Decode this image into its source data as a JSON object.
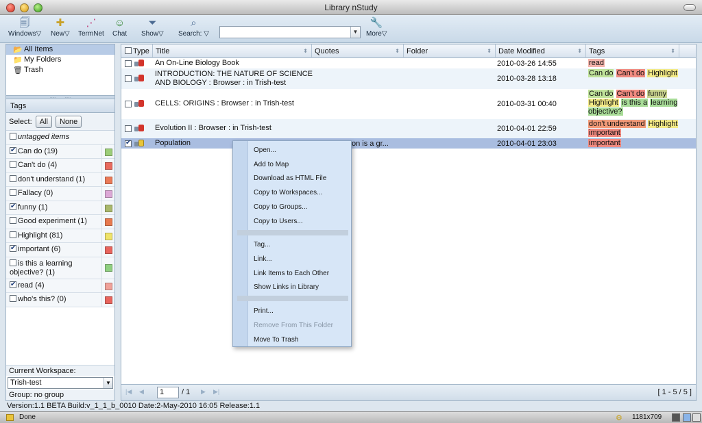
{
  "window": {
    "title": "Library nStudy"
  },
  "toolbar": {
    "windows": "Windows▽",
    "new": "New▽",
    "termnet": "TermNet",
    "chat": "Chat",
    "show": "Show▽",
    "search": "Search: ▽",
    "search_value": "",
    "more": "More▽"
  },
  "nav": {
    "all_items": "All Items",
    "my_folders": "My Folders",
    "trash": "Trash"
  },
  "tags_panel": {
    "header": "Tags",
    "select_label": "Select:",
    "all_button": "All",
    "none_button": "None",
    "untagged": "untagged items",
    "items": [
      {
        "label": "Can do (19)",
        "checked": true,
        "color": "#9ccd78"
      },
      {
        "label": "Can't do (4)",
        "checked": false,
        "color": "#e86a5e"
      },
      {
        "label": "don't understand (1)",
        "checked": false,
        "color": "#ea7a58"
      },
      {
        "label": "Fallacy (0)",
        "checked": false,
        "color": "#dca8d6"
      },
      {
        "label": "funny (1)",
        "checked": true,
        "color": "#a9b86c"
      },
      {
        "label": "Good experiment (1)",
        "checked": false,
        "color": "#e7794e"
      },
      {
        "label": "Highlight (81)",
        "checked": false,
        "color": "#efe36a"
      },
      {
        "label": "important (6)",
        "checked": true,
        "color": "#e8645d"
      },
      {
        "label": "is this a learning objective? (1)",
        "checked": false,
        "color": "#8fcf80"
      },
      {
        "label": "read (4)",
        "checked": true,
        "color": "#f0a29a"
      },
      {
        "label": "who's this? (0)",
        "checked": false,
        "color": "#e8645d"
      }
    ]
  },
  "workspace": {
    "label": "Current Workspace:",
    "value": "Trish-test",
    "group": "Group: no group"
  },
  "grid": {
    "columns": {
      "type": "Type",
      "title": "Title",
      "quotes": "Quotes",
      "folder": "Folder",
      "date_modified": "Date Modified",
      "tags": "Tags"
    },
    "rows": [
      {
        "title": [
          "An On-Line Biology Book"
        ],
        "quotes": "",
        "date": "2010-03-26 14:55",
        "checked": false,
        "icon": "doc",
        "tags": [
          {
            "t": "read",
            "c": "#f4b3ab"
          }
        ]
      },
      {
        "title": [
          "INTRODUCTION: THE NATURE OF SCIENCE",
          "AND BIOLOGY : Browser : in Trish-test"
        ],
        "quotes": "",
        "date": "2010-03-28 13:18",
        "checked": false,
        "icon": "doc",
        "tags": [
          {
            "t": "Can do",
            "c": "#bfe29a"
          },
          {
            "t": "Can't do",
            "c": "#f08a80"
          },
          {
            "t": "Highlight",
            "c": "#f3ea86"
          }
        ]
      },
      {
        "title": [
          "CELLS: ORIGINS : Browser : in Trish-test"
        ],
        "quotes": "",
        "date": "2010-03-31 00:40",
        "checked": false,
        "icon": "doc",
        "tags": [
          {
            "t": "Can do",
            "c": "#bfe29a"
          },
          {
            "t": "Can't do",
            "c": "#f08a80"
          },
          {
            "t": "funny",
            "c": "#c9d48e"
          },
          {
            "t": "Highlight",
            "c": "#f3ea86"
          },
          {
            "t": "is this a",
            "c": "#a8dc98"
          },
          {
            "t": "learning objective?",
            "c": "#a8dc98"
          }
        ]
      },
      {
        "title": [
          "Evolution II : Browser : in Trish-test"
        ],
        "quotes": "",
        "date": "2010-04-01 22:59",
        "checked": false,
        "icon": "doc",
        "tags": [
          {
            "t": "don't understand",
            "c": "#f29a78"
          },
          {
            "t": "Highlight",
            "c": "#f3ea86"
          },
          {
            "t": "important",
            "c": "#f08a80"
          }
        ]
      },
      {
        "title": [
          "Population"
        ],
        "quotes": "on is a gr...",
        "date": "2010-04-01 23:03",
        "checked": true,
        "icon": "note",
        "tags": [
          {
            "t": "important",
            "c": "#f08a80"
          }
        ]
      }
    ]
  },
  "context_menu": {
    "open": "Open...",
    "add_to_map": "Add to Map",
    "download_html": "Download as HTML File",
    "copy_workspaces": "Copy to Workspaces...",
    "copy_groups": "Copy to Groups...",
    "copy_users": "Copy to Users...",
    "tag": "Tag...",
    "link": "Link...",
    "link_each_other": "Link Items to Each Other",
    "show_links": "Show Links in Library",
    "print": "Print...",
    "remove_folder": "Remove From This Folder",
    "move_trash": "Move To Trash"
  },
  "pager": {
    "page": "1",
    "of": "/ 1",
    "range": "[ 1 - 5 / 5 ]"
  },
  "version_bar": "Version:1.1 BETA Build:v_1_1_b_0010 Date:2-May-2010 16:05 Release:1.1",
  "status": {
    "done": "Done",
    "size": "1181x709"
  }
}
